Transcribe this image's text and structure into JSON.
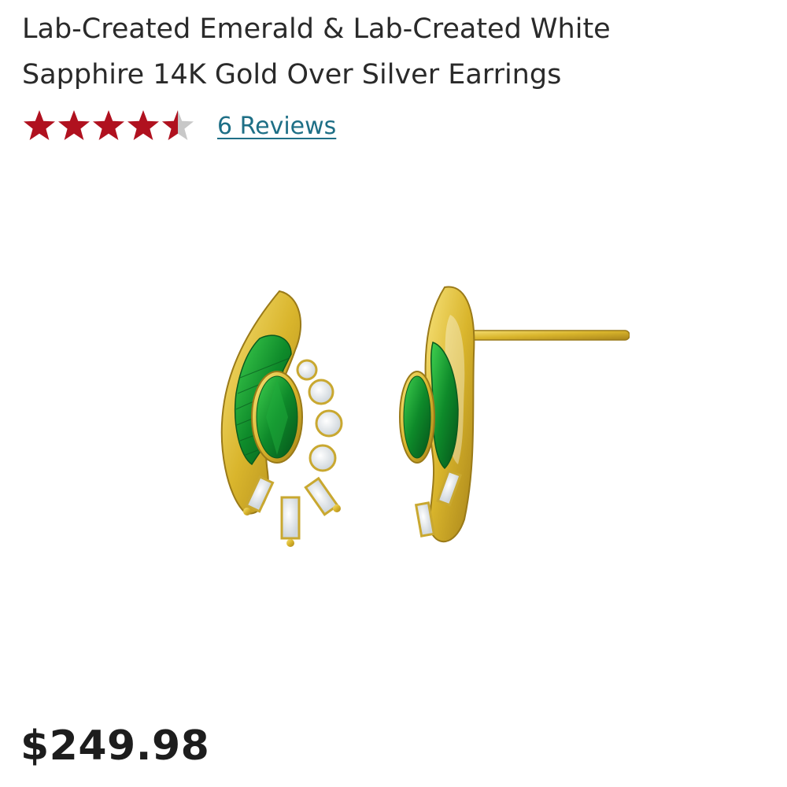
{
  "product": {
    "title": "Lab-Created Emerald & Lab-Created White Sapphire 14K Gold Over Silver Earrings",
    "price": "$249.98"
  },
  "rating": {
    "value": 4.5,
    "max": 5,
    "reviews_label": "6 Reviews",
    "star_color": "#b0111f",
    "empty_star_color": "#c8c8c8"
  },
  "image": {
    "alt": "Emerald and white sapphire gold earrings"
  },
  "colors": {
    "link": "#1e6f86",
    "text": "#2a2a2a"
  }
}
